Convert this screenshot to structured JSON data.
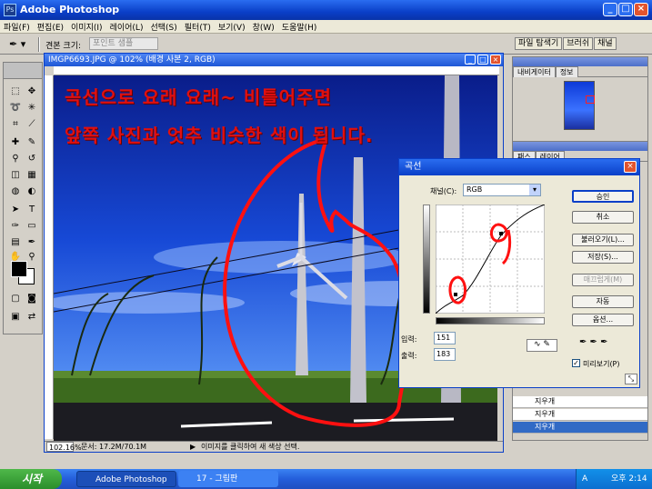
{
  "window": {
    "title": "Adobe Photoshop"
  },
  "menu": [
    "파일(F)",
    "편집(E)",
    "이미지(I)",
    "레이어(L)",
    "선택(S)",
    "필터(T)",
    "보기(V)",
    "창(W)",
    "도움말(H)"
  ],
  "options": {
    "sample_label": "견본 크기:",
    "sample_value": "포인트 샘플"
  },
  "palette_well": [
    "파일 탐색기",
    "브러쉬",
    "채널"
  ],
  "document": {
    "title": "IMGP6693.JPG @ 102% (배경 사본 2, RGB)",
    "overlay_line1": "곡선으로 요래 요래~ 비틀어주면",
    "overlay_line2": "앞쪽 사진과 엇추 비슷한 색이 됩니다.",
    "zoom": "102.16%",
    "doc_info": "문서: 17.2M/70.1M",
    "status_hint": "이미지를 클릭하여 새 색상 선택."
  },
  "navigator": {
    "tabs": [
      "내비게이터",
      "정보"
    ]
  },
  "layers": {
    "tabs": [
      "패스",
      "레이어"
    ],
    "rows": [
      "지우개",
      "지우개",
      "지우개"
    ]
  },
  "curves": {
    "title": "곡선",
    "channel_label": "채널(C):",
    "channel_value": "RGB",
    "input_label": "입력:",
    "input_value": "151",
    "output_label": "출력:",
    "output_value": "183",
    "buttons": [
      "승인",
      "취소",
      "불러오기(L)...",
      "저장(S)...",
      "매끄럽게(M)",
      "자동",
      "옵션..."
    ],
    "preview_label": "미리보기(P)",
    "annotation_0": "0",
    "annotation_9": "9"
  },
  "taskbar": {
    "start": "시작",
    "tasks": [
      "Adobe Photoshop",
      "17 - 그림판"
    ],
    "clock": "오후 2:14",
    "ime": "A"
  }
}
